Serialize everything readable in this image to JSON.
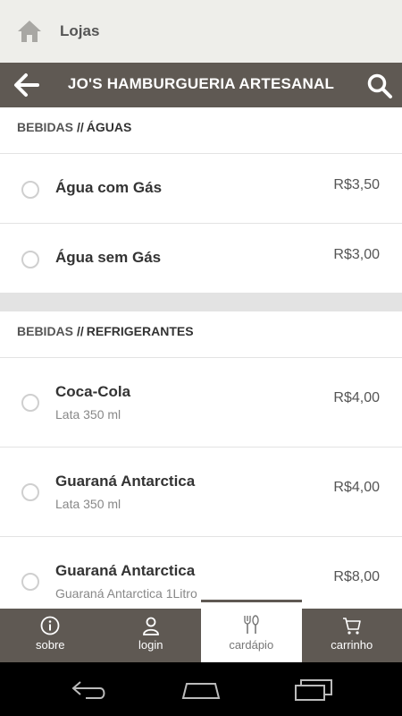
{
  "topbar": {
    "title": "Lojas",
    "icon": "home-icon"
  },
  "header": {
    "store_name": "JO'S HAMBURGUERIA ARTESANAL",
    "back_icon": "arrow-left-icon",
    "search_icon": "search-icon"
  },
  "sections": [
    {
      "category": "BEBIDAS",
      "separator": "//",
      "subcategory": "ÁGUAS",
      "items": [
        {
          "name": "Água com Gás",
          "price": "R$3,50"
        },
        {
          "name": "Água sem Gás",
          "price": "R$3,00"
        }
      ]
    },
    {
      "category": "BEBIDAS",
      "separator": "//",
      "subcategory": "REFRIGERANTES",
      "items": [
        {
          "name": "Coca-Cola",
          "desc": "Lata 350 ml",
          "price": "R$4,00"
        },
        {
          "name": "Guaraná Antarctica",
          "desc": "Lata 350 ml",
          "price": "R$4,00"
        },
        {
          "name": "Guaraná Antarctica",
          "desc": "Guaraná Antarctica 1Litro",
          "price": "R$8,00"
        }
      ]
    }
  ],
  "bottom_nav": [
    {
      "label": "sobre",
      "icon": "info-icon"
    },
    {
      "label": "login",
      "icon": "user-icon"
    },
    {
      "label": "cardápio",
      "icon": "cutlery-icon",
      "active": true
    },
    {
      "label": "carrinho",
      "icon": "cart-icon"
    }
  ],
  "colors": {
    "header_bg": "#5f5953",
    "topbar_bg": "#eeeeea",
    "divider": "#e3e3e3"
  }
}
